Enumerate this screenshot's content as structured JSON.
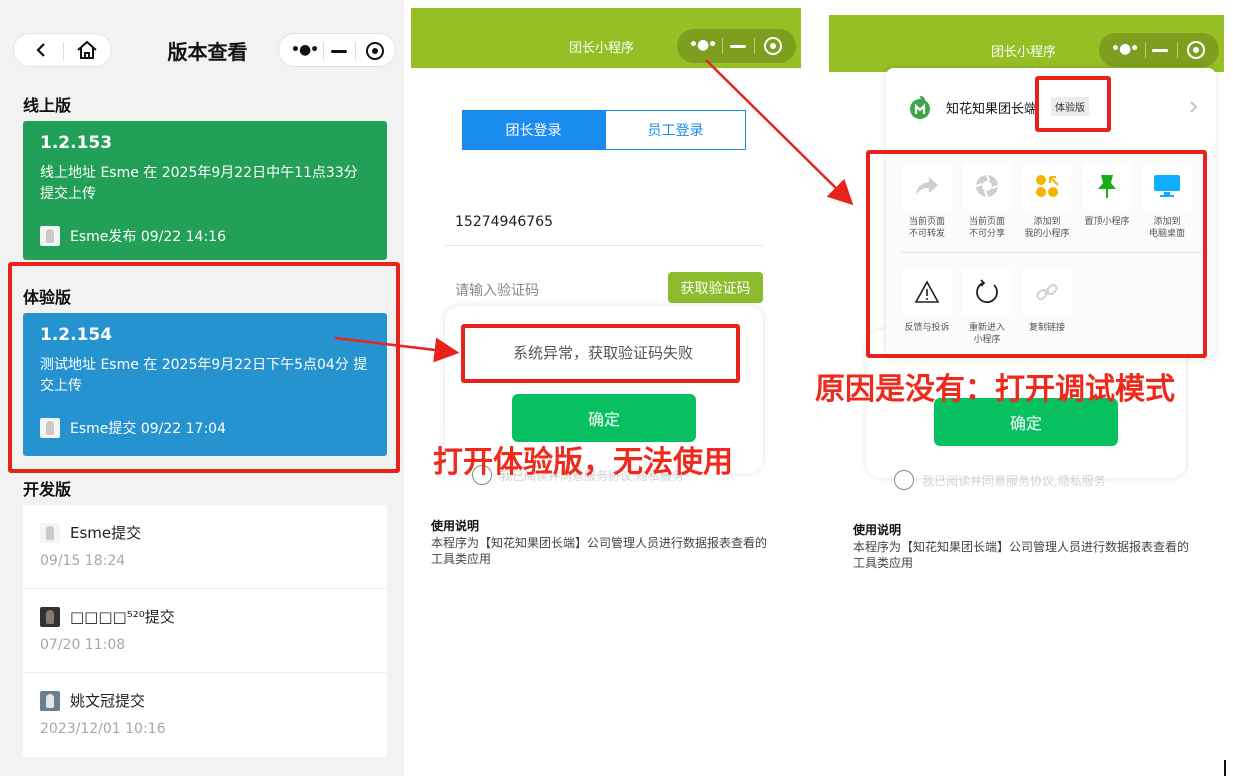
{
  "left": {
    "title": "版本查看",
    "online": {
      "section": "线上版",
      "version": "1.2.153",
      "desc": "线上地址 Esme 在 2025年9月22日中午11点33分提交上传",
      "footer": "Esme发布  09/22 14:16",
      "color": "#22a058"
    },
    "trial": {
      "section": "体验版",
      "version": "1.2.154",
      "desc": "测试地址 Esme 在 2025年9月22日下午5点04分 提交上传",
      "footer": "Esme提交  09/22 17:04",
      "color": "#2593cf"
    },
    "dev": {
      "section": "开发版",
      "items": [
        {
          "who": "Esme提交",
          "time": "09/15 18:24"
        },
        {
          "who": "□□□□⁵²⁰提交",
          "time": "07/20 11:08"
        },
        {
          "who": "姚文冠提交",
          "time": "2023/12/01 10:16"
        }
      ]
    }
  },
  "middle": {
    "bar_title": "团长小程序",
    "tabs": [
      "团长登录",
      "员工登录"
    ],
    "phone": "15274946765",
    "code_placeholder": "请输入验证码",
    "get_code": "获取验证码",
    "error": "系统异常，获取验证码失败",
    "confirm": "确定",
    "agree": "我已阅读并同意服务协议,隐私服务",
    "note_title": "使用说明",
    "note_body": "本程序为【知花知果团长端】公司管理人员进行数据报表查看的工具类应用",
    "annotation": "打开体验版，无法使用"
  },
  "right": {
    "bar_title": "团长小程序",
    "app_name": "知花知果团长端",
    "badge": "体验版",
    "options": [
      {
        "label": "当前页面\n不可转发",
        "icon": "share-arrow-icon"
      },
      {
        "label": "当前页面\n不可分享",
        "icon": "aperture-icon"
      },
      {
        "label": "添加到\n我的小程序",
        "icon": "add-mini-program-icon"
      },
      {
        "label": "置顶小程序",
        "icon": "pin-icon"
      },
      {
        "label": "添加到\n电脑桌面",
        "icon": "monitor-icon"
      },
      {
        "label": "反馈与投诉",
        "icon": "warning-icon"
      },
      {
        "label": "重新进入\n小程序",
        "icon": "reload-icon"
      },
      {
        "label": "复制链接",
        "icon": "link-icon"
      }
    ],
    "confirm": "确定",
    "agree": "我已阅读并同意服务协议,隐私服务",
    "note_title": "使用说明",
    "note_body": "本程序为【知花知果团长端】公司管理人员进行数据报表查看的工具类应用",
    "annotation": "原因是没有：打开调试模式"
  },
  "colors": {
    "green_bar": "#95bf24",
    "annotation_red": "#ee2a1d",
    "wechat_green": "#07c160"
  }
}
